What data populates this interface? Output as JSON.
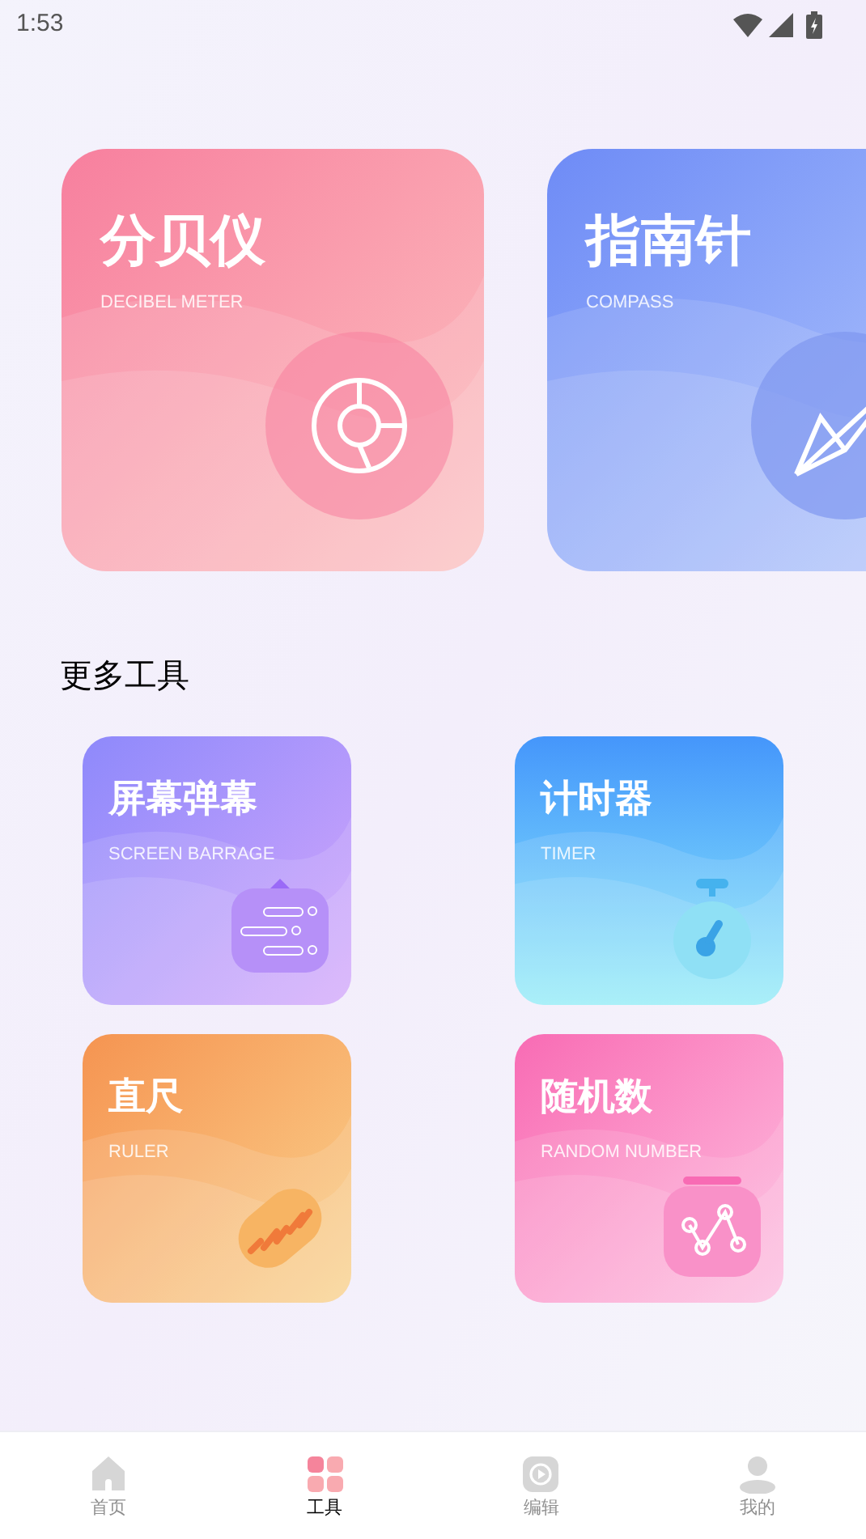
{
  "status_bar": {
    "time": "1:53"
  },
  "featured": [
    {
      "kind": "decibel",
      "title": "分贝仪",
      "subtitle": "DECIBEL METER"
    },
    {
      "kind": "compass",
      "title": "指南针",
      "subtitle": "COMPASS"
    }
  ],
  "more_tools": {
    "heading": "更多工具",
    "items": [
      {
        "kind": "barrage",
        "title": "屏幕弹幕",
        "subtitle": "SCREEN BARRAGE"
      },
      {
        "kind": "timer",
        "title": "计时器",
        "subtitle": "TIMER"
      },
      {
        "kind": "ruler",
        "title": "直尺",
        "subtitle": "RULER"
      },
      {
        "kind": "random",
        "title": "随机数",
        "subtitle": "RANDOM NUMBER"
      }
    ]
  },
  "bottom_nav": [
    {
      "kind": "home",
      "label": "首页",
      "selected": false
    },
    {
      "kind": "tools",
      "label": "工具",
      "selected": true
    },
    {
      "kind": "edit",
      "label": "编辑",
      "selected": false
    },
    {
      "kind": "mine",
      "label": "我的",
      "selected": false
    }
  ]
}
